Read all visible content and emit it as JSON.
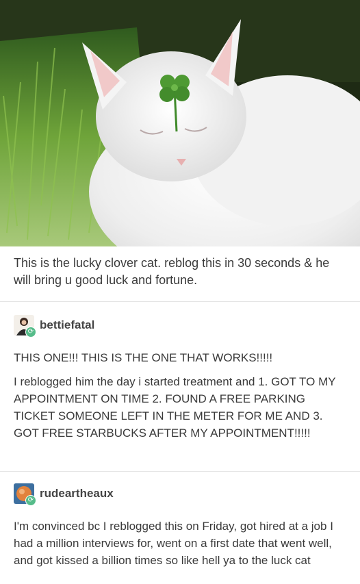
{
  "post": {
    "caption": "This is the lucky clover cat. reblog this in 30 seconds & he will bring u good luck and fortune."
  },
  "reblogs": [
    {
      "username": "bettiefatal",
      "avatar_icon": "person-avatar-icon",
      "paragraphs": [
        "THIS ONE!!! THIS IS THE ONE THAT WORKS!!!!!",
        "I reblogged him the day i started treatment and 1. GOT TO MY APPOINTMENT ON TIME 2. FOUND A FREE PARKING TICKET SOMEONE LEFT IN THE METER FOR ME AND 3. GOT FREE STARBUCKS AFTER MY APPOINTMENT!!!!!"
      ]
    },
    {
      "username": "rudeartheaux",
      "avatar_icon": "orange-avatar-icon",
      "paragraphs": [
        "I'm convinced bc I reblogged this on Friday, got hired at a job I had a million interviews for, went on a first date that went well, and got kissed a billion times so like hell ya to the luck cat"
      ]
    }
  ],
  "colors": {
    "reblog_badge": "#56bc8a",
    "text": "#3a3a3a",
    "divider": "#e4e4e4"
  },
  "icons": {
    "reblog_badge": "⟳"
  }
}
